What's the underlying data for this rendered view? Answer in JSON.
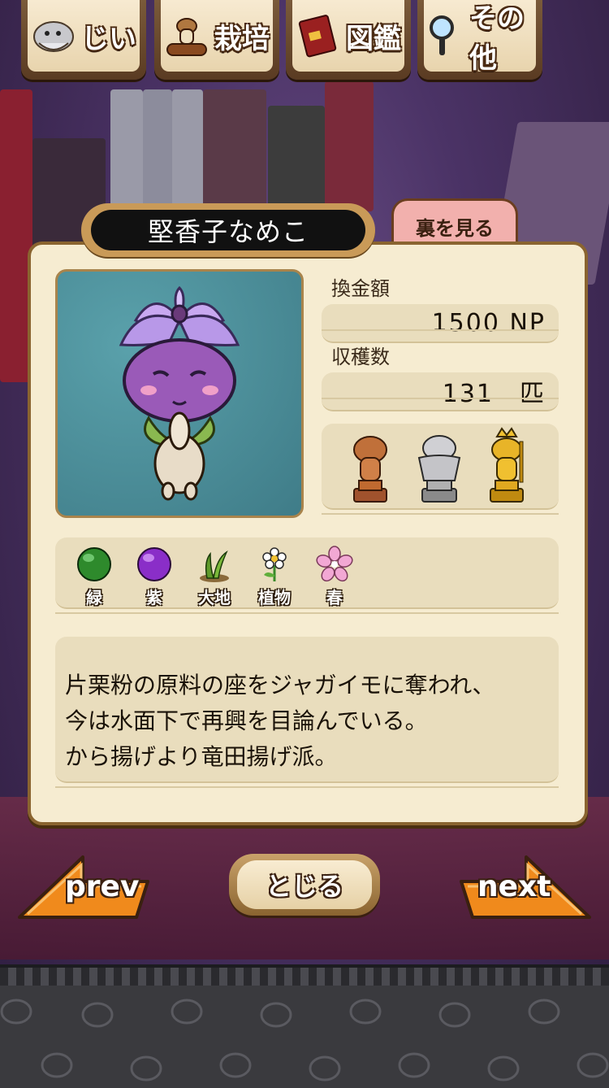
{
  "top_tabs": [
    {
      "label": "じい",
      "icon": "old-man-icon"
    },
    {
      "label": "栽培",
      "icon": "mushroom-log-icon"
    },
    {
      "label": "図鑑",
      "icon": "book-icon"
    },
    {
      "label": "その他",
      "icon": "magnifier-icon"
    }
  ],
  "entry": {
    "name": "堅香子なめこ",
    "back_button": "裏を見る",
    "price_label": "換金額",
    "price_value": "1500 NP",
    "harvest_label": "収穫数",
    "harvest_value": "131　匹",
    "trophies": [
      "bronze-trophy-icon",
      "silver-trophy-icon",
      "gold-trophy-icon"
    ],
    "attributes": [
      {
        "label": "緑",
        "icon": "green-orb-icon",
        "color": "#2e8a2c"
      },
      {
        "label": "紫",
        "icon": "purple-orb-icon",
        "color": "#8a2ec8"
      },
      {
        "label": "大地",
        "icon": "grass-icon",
        "color": "#5f9a2a"
      },
      {
        "label": "植物",
        "icon": "white-flower-icon",
        "color": "#ffffff"
      },
      {
        "label": "春",
        "icon": "cherry-blossom-icon",
        "color": "#f2a8d4"
      }
    ],
    "description": [
      "片栗粉の原料の座をジャガイモに奪われ、",
      "今は水面下で再興を目論んでいる。",
      "から揚げより竜田揚げ派。"
    ]
  },
  "nav": {
    "prev": "prev",
    "close": "とじる",
    "next": "next"
  },
  "colors": {
    "card_bg": "#f6ecd1",
    "field_bg": "#e9ddbd",
    "back_tab": "#f2b0ad",
    "arrow_orange": "#f08a1c"
  }
}
